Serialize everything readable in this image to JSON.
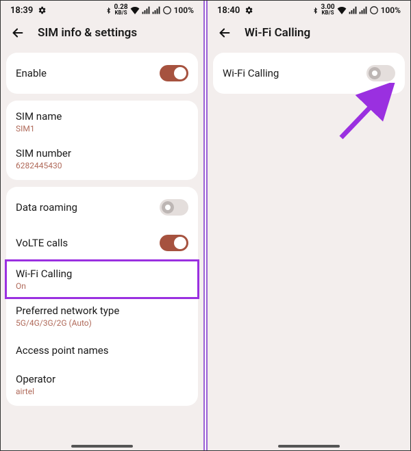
{
  "left": {
    "status": {
      "time": "18:39",
      "speed_val": "0.28",
      "speed_unit": "KB/S",
      "battery": "100%"
    },
    "title": "SIM info & settings",
    "enable": {
      "label": "Enable"
    },
    "sim": {
      "name_label": "SIM name",
      "name_value": "SIM1",
      "number_label": "SIM number",
      "number_value": "6282445430"
    },
    "net": {
      "roaming_label": "Data roaming",
      "volte_label": "VoLTE calls",
      "wifi_label": "Wi-Fi Calling",
      "wifi_sub": "On",
      "pref_label": "Preferred network type",
      "pref_sub": "5G/4G/3G/2G (Auto)",
      "apn_label": "Access point names",
      "op_label": "Operator",
      "op_sub": "airtel"
    }
  },
  "right": {
    "status": {
      "time": "18:40",
      "speed_val": "3.00",
      "speed_unit": "KB/S",
      "battery": "100%"
    },
    "title": "Wi-Fi Calling",
    "row": {
      "label": "Wi-Fi Calling"
    }
  }
}
